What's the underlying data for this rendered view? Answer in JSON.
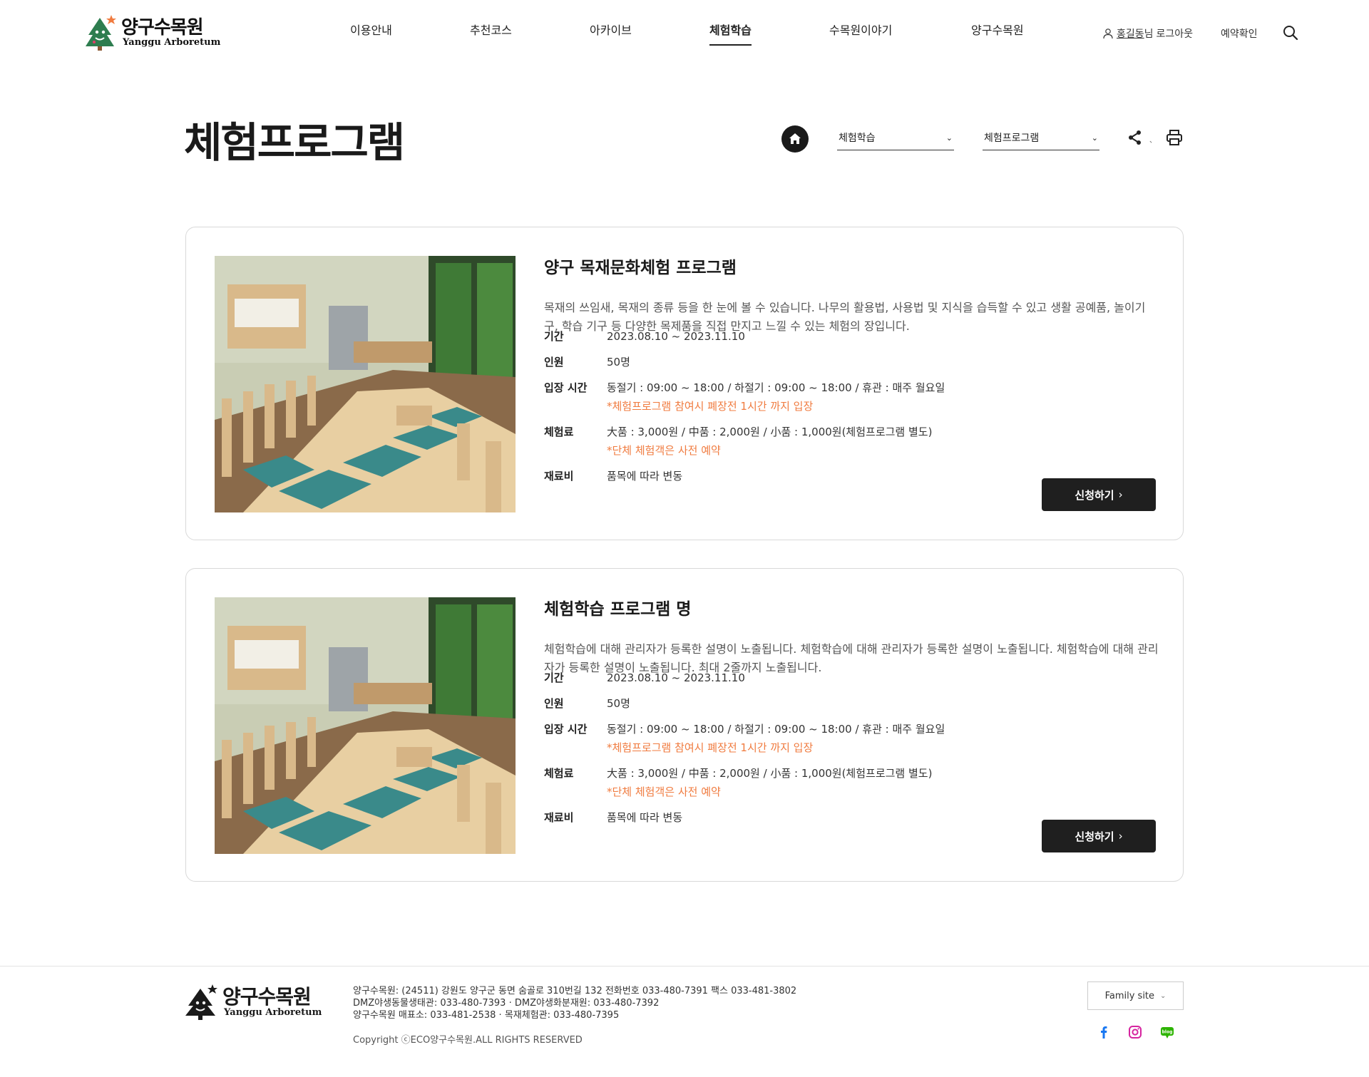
{
  "header": {
    "logo_ko": "양구수목원",
    "logo_en": "Yanggu Arboretum",
    "nav": [
      {
        "label": "이용안내"
      },
      {
        "label": "추천코스"
      },
      {
        "label": "아카이브"
      },
      {
        "label": "체험학습",
        "active": true
      },
      {
        "label": "수목원이야기"
      },
      {
        "label": "양구수목원"
      }
    ],
    "user_name": "홍길동",
    "user_suffix": "님",
    "logout": "로그아웃",
    "reservation": "예약확인",
    "icons": {
      "user": "user-icon",
      "search": "search-icon"
    }
  },
  "page": {
    "title": "체험프로그램",
    "breadcrumb": {
      "select1": "체험학습",
      "select2": "체험프로그램",
      "separator": "、"
    },
    "icons": {
      "home": "home-icon",
      "share": "share-icon",
      "print": "print-icon"
    }
  },
  "programs": [
    {
      "title": "양구 목재문화체험 프로그램",
      "desc": "목재의 쓰임새, 목재의 종류 등을 한 눈에 볼 수 있습니다. 나무의 활용법, 사용법 및 지식을 습득할 수 있고 생활 공예품, 놀이기구, 학습 기구 등 다양한 목제품을 직접 만지고 느낄 수 있는 체험의 장입니다.",
      "period_label": "기간",
      "period": "2023.08.10 ~ 2023.11.10",
      "people_label": "인원",
      "people": "50명",
      "hours_label": "입장 시간",
      "hours": "동절기 : 09:00 ~ 18:00 / 하절기 : 09:00 ~ 18:00 / 휴관 : 매주 월요일",
      "hours_note": "*체험프로그램 참여시 폐장전 1시간 까지 입장",
      "fee_label": "체험료",
      "fee": "大품 : 3,000원 / 中품 : 2,000원 / 小품 : 1,000원(체험프로그램 별도)",
      "fee_note": "*단체 체험객은 사전 예약",
      "material_label": "재료비",
      "material": "품목에 따라 변동",
      "apply": "신청하기"
    },
    {
      "title": "체험학습 프로그램 명",
      "desc": "체험학습에 대해 관리자가 등록한 설명이 노출됩니다. 체험학습에 대해 관리자가 등록한 설명이 노출됩니다. 체험학습에 대해 관리자가 등록한 설명이 노출됩니다. 최대 2줄까지 노출됩니다.",
      "period_label": "기간",
      "period": "2023.08.10 ~ 2023.11.10",
      "people_label": "인원",
      "people": "50명",
      "hours_label": "입장 시간",
      "hours": "동절기 : 09:00 ~ 18:00 / 하절기 : 09:00 ~ 18:00 / 휴관 : 매주 월요일",
      "hours_note": "*체험프로그램 참여시 폐장전 1시간 까지 입장",
      "fee_label": "체험료",
      "fee": "大품 : 3,000원 / 中품 : 2,000원 / 小품 : 1,000원(체험프로그램 별도)",
      "fee_note": "*단체 체험객은 사전 예약",
      "material_label": "재료비",
      "material": "품목에 따라 변동",
      "apply": "신청하기"
    }
  ],
  "footer": {
    "logo_ko": "양구수목원",
    "logo_en": "Yanggu Arboretum",
    "address_lines": [
      "양구수목원: (24511) 강원도 양구군 동면 숨골로 310번길 132 전화번호 033-480-7391 팩스 033-481-3802",
      "DMZ야생동물생태관: 033-480-7393 · DMZ야생화분재원: 033-480-7392",
      "양구수목원 매표소: 033-481-2538 · 목재체험관: 033-480-7395"
    ],
    "copyright": "Copyright ⓒECO양구수목원.ALL RIGHTS RESERVED",
    "family_site": "Family site",
    "sns": [
      "facebook-icon",
      "instagram-icon",
      "blog-icon"
    ]
  },
  "colors": {
    "accent_orange": "#f07b3f",
    "button_dark": "#1f1f1f",
    "facebook": "#1877f2",
    "instagram": "#d6249f",
    "blog": "#2db400"
  }
}
